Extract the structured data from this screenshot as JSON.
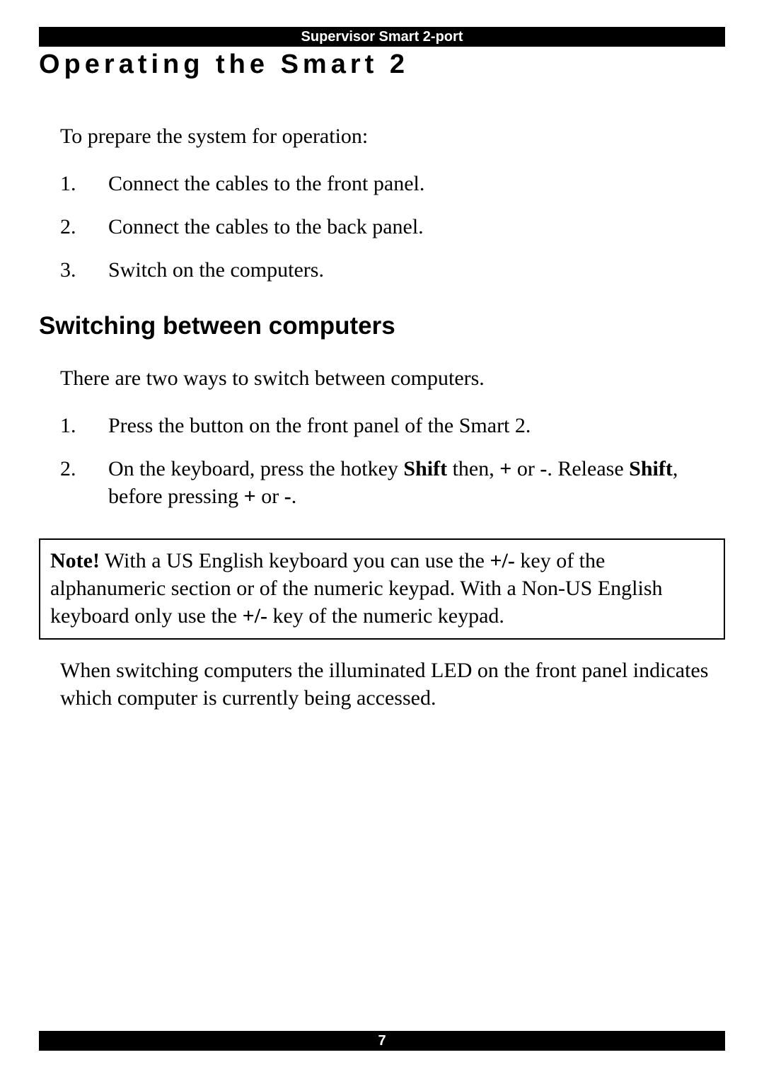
{
  "header": "Supervisor Smart 2-port",
  "title": "Operating the Smart 2",
  "intro": "To prepare the system for operation:",
  "steps1": [
    "Connect the cables to the front panel.",
    "Connect the cables to the back panel.",
    "Switch on the computers."
  ],
  "subheading": "Switching between computers",
  "intro2": "There are two ways to switch between computers.",
  "steps2_item1": "Press the button on the front panel of the Smart 2.",
  "steps2_item2_a": "On the keyboard, press the hotkey ",
  "steps2_item2_b": "Shift",
  "steps2_item2_c": " then, ",
  "steps2_item2_d": "+",
  "steps2_item2_e": " or ",
  "steps2_item2_f": "-",
  "steps2_item2_g": ". Release ",
  "steps2_item2_h": "Shift",
  "steps2_item2_i": ", before pressing ",
  "steps2_item2_j": "+",
  "steps2_item2_k": " or ",
  "steps2_item2_l": "-",
  "steps2_item2_m": ".",
  "note_label": "Note!",
  "note_a": " With a US English keyboard you can use the ",
  "note_b": "+/-",
  "note_c": " key of the alphanumeric section or of the numeric keypad. With a Non-US English keyboard only use the ",
  "note_d": "+/-",
  "note_e": " key of the numeric keypad.",
  "closing": "When switching computers the illuminated LED on the front panel indicates which computer is currently being accessed.",
  "page_number": "7"
}
